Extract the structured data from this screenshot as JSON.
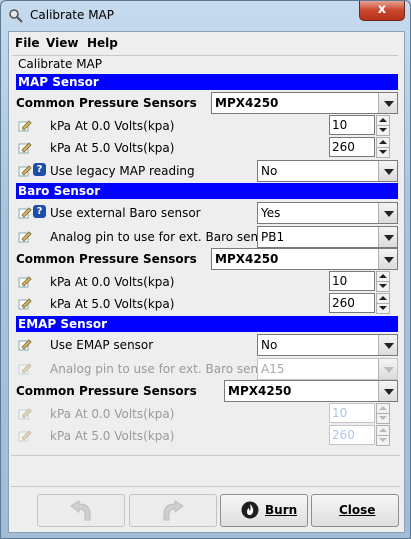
{
  "window": {
    "title": "Calibrate MAP"
  },
  "menu": {
    "file": "File",
    "view": "View",
    "help": "Help"
  },
  "panel_title": "Calibrate MAP",
  "map_sensor": {
    "header": "MAP Sensor",
    "common_label": "Common Pressure Sensors",
    "common_value": "MPX4250",
    "kpa0_label": "kPa At 0.0 Volts(kpa)",
    "kpa0_value": "10",
    "kpa5_label": "kPa At 5.0 Volts(kpa)",
    "kpa5_value": "260",
    "legacy_label": "Use legacy MAP reading",
    "legacy_value": "No"
  },
  "baro_sensor": {
    "header": "Baro Sensor",
    "external_label": "Use external Baro sensor",
    "external_value": "Yes",
    "pin_label": "Analog pin to use for ext. Baro sensor",
    "pin_value": "PB1",
    "common_label": "Common Pressure Sensors",
    "common_value": "MPX4250",
    "kpa0_label": "kPa At 0.0 Volts(kpa)",
    "kpa0_value": "10",
    "kpa5_label": "kPa At 5.0 Volts(kpa)",
    "kpa5_value": "260"
  },
  "emap_sensor": {
    "header": "EMAP Sensor",
    "use_label": "Use EMAP sensor",
    "use_value": "No",
    "pin_label": "Analog pin to use for ext. Baro sensor",
    "pin_value": "A15",
    "common_label": "Common Pressure Sensors",
    "common_value": "MPX4250",
    "kpa0_label": "kPa At 0.0 Volts(kpa)",
    "kpa0_value": "10",
    "kpa5_label": "kPa At 5.0 Volts(kpa)",
    "kpa5_value": "260"
  },
  "buttons": {
    "burn": "Burn",
    "close": "Close",
    "close_x": "x"
  },
  "icons": {
    "edit": "pencil-edit-icon",
    "help": "help-icon",
    "undo": "undo-icon",
    "redo": "redo-icon",
    "burn": "flame-icon"
  },
  "colors": {
    "section_header": "#0000ff",
    "disabled_value": "#a9c6ef"
  }
}
